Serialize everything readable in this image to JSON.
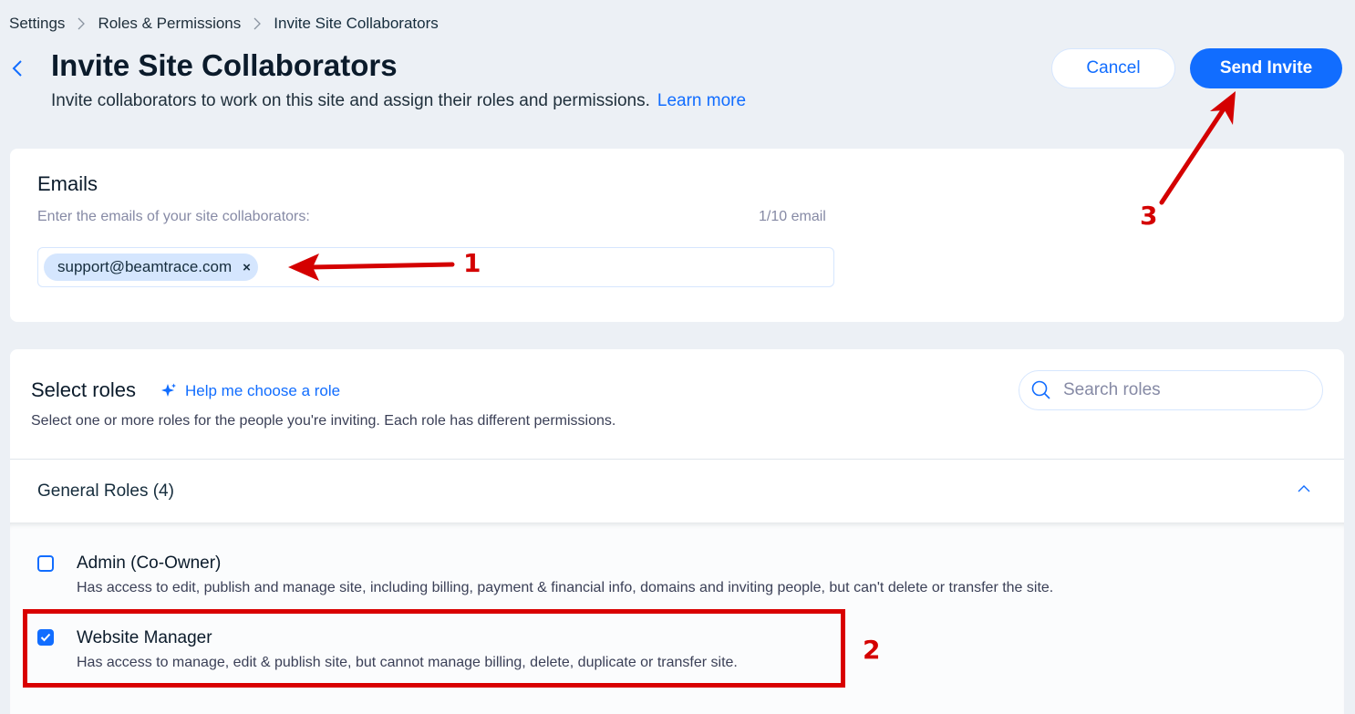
{
  "breadcrumb": {
    "items": [
      "Settings",
      "Roles & Permissions",
      "Invite Site Collaborators"
    ]
  },
  "header": {
    "title": "Invite Site Collaborators",
    "subtitle": "Invite collaborators to work on this site and assign their roles and permissions.",
    "learn_more": "Learn more",
    "cancel_label": "Cancel",
    "send_label": "Send Invite"
  },
  "emails": {
    "title": "Emails",
    "hint": "Enter the emails of your site collaborators:",
    "count": "1/10 email",
    "chips": [
      "support@beamtrace.com"
    ],
    "remove_glyph": "×"
  },
  "roles": {
    "title": "Select roles",
    "help_link": "Help me choose a role",
    "description": "Select one or more roles for the people you're inviting. Each role has different permissions.",
    "search_placeholder": "Search roles",
    "group_title": "General Roles (4)",
    "items": [
      {
        "name": "Admin (Co-Owner)",
        "description": "Has access to edit, publish and manage site, including billing, payment & financial info, domains and inviting people, but can't delete or transfer the site.",
        "checked": false
      },
      {
        "name": "Website Manager",
        "description": "Has access to manage, edit & publish site, but cannot manage billing, delete, duplicate or transfer site.",
        "checked": true
      }
    ]
  },
  "annotations": {
    "labels": [
      "1",
      "2",
      "3"
    ],
    "color": "#d90000"
  },
  "colors": {
    "accent": "#116dff",
    "background": "#ecf0f5",
    "chip": "#d5e6fe"
  },
  "icons": [
    "chevron-right-icon",
    "back-arrow-icon",
    "sparkle-icon",
    "search-icon",
    "chevron-up-icon",
    "checkmark-icon",
    "close-icon"
  ]
}
